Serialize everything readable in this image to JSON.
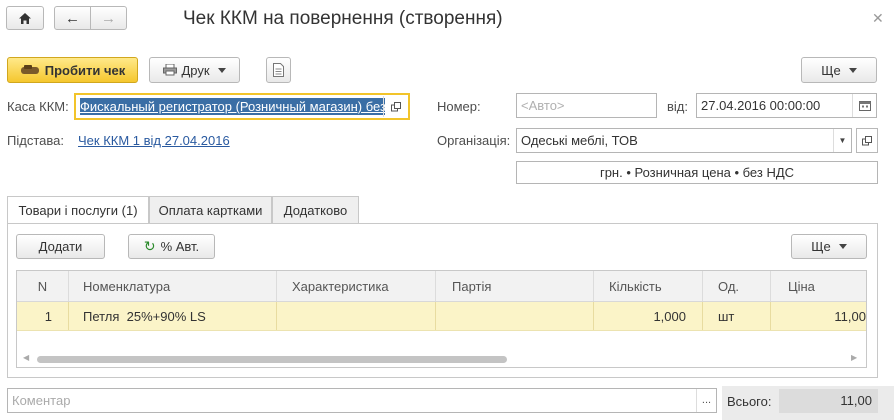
{
  "window": {
    "title": "Чек ККМ на повернення (створення)"
  },
  "toolbar": {
    "post_label": "Пробити чек",
    "print_label": "Друк",
    "more_label": "Ще"
  },
  "form": {
    "cash_register_label": "Каса ККМ:",
    "cash_register_value": "Фискальный регистратор (Розничный магазин) без",
    "number_label": "Номер:",
    "number_placeholder": "<Авто>",
    "date_label": "від:",
    "date_value": "27.04.2016 00:00:00",
    "basis_label": "Підстава:",
    "basis_value": "Чек ККМ 1 від 27.04.2016",
    "organization_label": "Організація:",
    "organization_value": "Одеські меблі, ТОВ",
    "price_info": "грн. • Розничная цена • без НДС"
  },
  "tabs": [
    {
      "label": "Товари і послуги (1)",
      "active": true
    },
    {
      "label": "Оплата картками",
      "active": false
    },
    {
      "label": "Додатково",
      "active": false
    }
  ],
  "table_toolbar": {
    "add_label": "Додати",
    "auto_percent_label": "% Авт.",
    "more_label": "Ще"
  },
  "table": {
    "columns": [
      "N",
      "Номенклатура",
      "Характеристика",
      "Партія",
      "Кількість",
      "Од.",
      "Ціна"
    ],
    "rows": [
      {
        "n": "1",
        "item": "Петля  25%+90% LS",
        "characteristic": "",
        "batch": "",
        "qty": "1,000",
        "unit": "шт",
        "price": "11,00"
      }
    ]
  },
  "footer": {
    "comment_placeholder": "Коментар",
    "total_label": "Всього:",
    "total_value": "11,00"
  },
  "colors": {
    "accent_yellow": "#f5c72e",
    "selection_blue": "#3a6ea5",
    "row_highlight": "#fbf4c8",
    "link": "#2a5aa0"
  }
}
